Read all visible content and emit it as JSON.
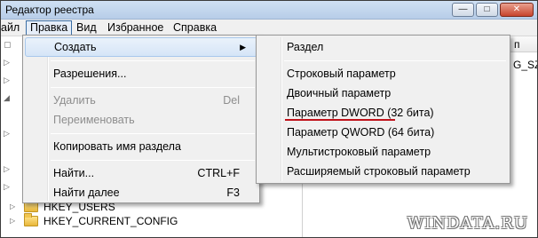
{
  "window": {
    "title": "Редактор реестра"
  },
  "menubar": {
    "items": [
      {
        "label": "айл"
      },
      {
        "label": "Правка"
      },
      {
        "label": "Вид"
      },
      {
        "label": "Избранное"
      },
      {
        "label": "Справка"
      }
    ]
  },
  "right_pane": {
    "column_header": "п",
    "visible_value": "G_SZ"
  },
  "tree": {
    "bottom_items": [
      "HKEY_USERS",
      "HKEY_CURRENT_CONFIG"
    ]
  },
  "edit_menu": {
    "create": "Создать",
    "permissions": "Разрешения...",
    "delete": "Удалить",
    "delete_shortcut": "Del",
    "rename": "Переименовать",
    "copy_key_name": "Копировать имя раздела",
    "find": "Найти...",
    "find_shortcut": "CTRL+F",
    "find_next": "Найти далее",
    "find_next_shortcut": "F3"
  },
  "create_submenu": {
    "key": "Раздел",
    "string_value": "Строковый параметр",
    "binary_value": "Двоичный параметр",
    "dword_value": "Параметр DWORD (32 бита)",
    "qword_value": "Параметр QWORD (64 бита)",
    "multi_string_value": "Мультистроковый параметр",
    "expandable_string_value": "Расширяемый строковый параметр"
  },
  "watermark": "WINDATA.RU",
  "colors": {
    "highlight_underline": "#c0121a",
    "menu_background": "#f0f0f0"
  }
}
